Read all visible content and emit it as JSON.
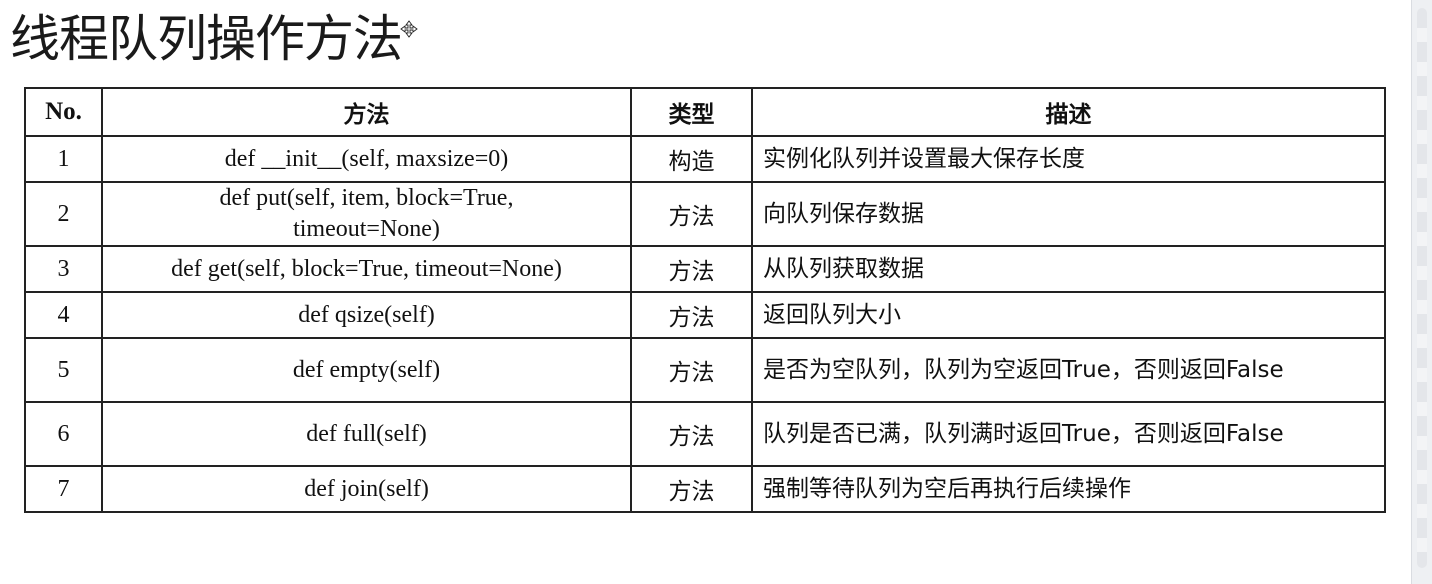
{
  "title": "线程队列操作方法",
  "table": {
    "headers": [
      "No.",
      "方法",
      "类型",
      "描述"
    ],
    "rows": [
      {
        "no": "1",
        "method": "def __init__(self, maxsize=0)",
        "type": "构造",
        "desc": "实例化队列并设置最大保存长度"
      },
      {
        "no": "2",
        "method": "def put(self, item, block=True, timeout=None)",
        "type": "方法",
        "desc": "向队列保存数据"
      },
      {
        "no": "3",
        "method": "def get(self, block=True, timeout=None)",
        "type": "方法",
        "desc": "从队列获取数据"
      },
      {
        "no": "4",
        "method": "def qsize(self)",
        "type": "方法",
        "desc": "返回队列大小"
      },
      {
        "no": "5",
        "method": "def empty(self)",
        "type": "方法",
        "desc": "是否为空队列，队列为空返回True，否则返回False"
      },
      {
        "no": "6",
        "method": "def full(self)",
        "type": "方法",
        "desc": "队列是否已满，队列满时返回True，否则返回False"
      },
      {
        "no": "7",
        "method": "def join(self)",
        "type": "方法",
        "desc": "强制等待队列为空后再执行后续操作"
      }
    ]
  },
  "icons": {
    "cursor": "move-cursor-icon"
  }
}
